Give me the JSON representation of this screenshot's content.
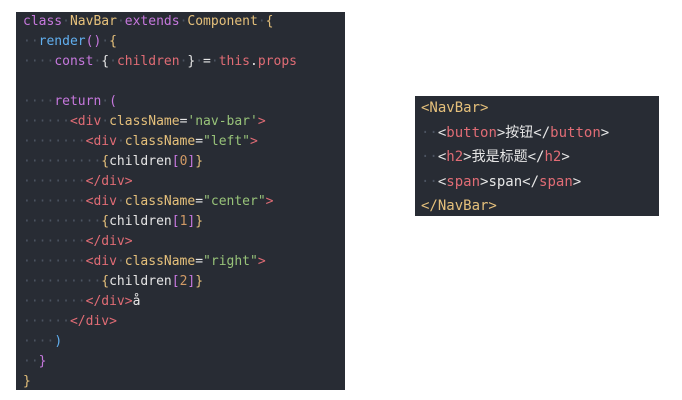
{
  "left_code": [
    [
      [
        "kw",
        "class"
      ],
      [
        "ind",
        "·"
      ],
      [
        "cls",
        "NavBar"
      ],
      [
        "ind",
        "·"
      ],
      [
        "kw",
        "extends"
      ],
      [
        "ind",
        "·"
      ],
      [
        "cls",
        "Component"
      ],
      [
        "ind",
        "·"
      ],
      [
        "brace",
        "{"
      ]
    ],
    [
      [
        "ind",
        "··"
      ],
      [
        "fn",
        "render"
      ],
      [
        "paren",
        "()"
      ],
      [
        "ind",
        "·"
      ],
      [
        "brace",
        "{"
      ]
    ],
    [
      [
        "ind",
        "····"
      ],
      [
        "kw",
        "const"
      ],
      [
        "ind",
        "·"
      ],
      [
        "txt",
        "{"
      ],
      [
        "ind",
        "·"
      ],
      [
        "tag",
        "children"
      ],
      [
        "ind",
        "·"
      ],
      [
        "txt",
        "}"
      ],
      [
        "ind",
        "·"
      ],
      [
        "txt",
        "="
      ],
      [
        "ind",
        "·"
      ],
      [
        "tag",
        "this"
      ],
      [
        "txt",
        "."
      ],
      [
        "tag",
        "props"
      ]
    ],
    [
      [
        "txt",
        ""
      ]
    ],
    [
      [
        "ind",
        "····"
      ],
      [
        "kw",
        "return"
      ],
      [
        "ind",
        "·"
      ],
      [
        "paren",
        "("
      ]
    ],
    [
      [
        "ind",
        "······"
      ],
      [
        "tag",
        "<div"
      ],
      [
        "ind",
        "·"
      ],
      [
        "attr",
        "className"
      ],
      [
        "txt",
        "="
      ],
      [
        "str",
        "'nav-bar'"
      ],
      [
        "tag",
        ">"
      ]
    ],
    [
      [
        "ind",
        "········"
      ],
      [
        "tag",
        "<div"
      ],
      [
        "ind",
        "·"
      ],
      [
        "attr",
        "className"
      ],
      [
        "txt",
        "="
      ],
      [
        "str",
        "\"left\""
      ],
      [
        "tag",
        ">"
      ]
    ],
    [
      [
        "ind",
        "··········"
      ],
      [
        "brace",
        "{"
      ],
      [
        "txt",
        "children"
      ],
      [
        "paren",
        "["
      ],
      [
        "num",
        "0"
      ],
      [
        "paren",
        "]"
      ],
      [
        "brace",
        "}"
      ]
    ],
    [
      [
        "ind",
        "········"
      ],
      [
        "tag",
        "</div>"
      ]
    ],
    [
      [
        "ind",
        "········"
      ],
      [
        "tag",
        "<div"
      ],
      [
        "ind",
        "·"
      ],
      [
        "attr",
        "className"
      ],
      [
        "txt",
        "="
      ],
      [
        "str",
        "\"center\""
      ],
      [
        "tag",
        ">"
      ]
    ],
    [
      [
        "ind",
        "··········"
      ],
      [
        "brace",
        "{"
      ],
      [
        "txt",
        "children"
      ],
      [
        "paren",
        "["
      ],
      [
        "num",
        "1"
      ],
      [
        "paren",
        "]"
      ],
      [
        "brace",
        "}"
      ]
    ],
    [
      [
        "ind",
        "········"
      ],
      [
        "tag",
        "</div>"
      ]
    ],
    [
      [
        "ind",
        "········"
      ],
      [
        "tag",
        "<div"
      ],
      [
        "ind",
        "·"
      ],
      [
        "attr",
        "className"
      ],
      [
        "txt",
        "="
      ],
      [
        "str",
        "\"right\""
      ],
      [
        "tag",
        ">"
      ]
    ],
    [
      [
        "ind",
        "··········"
      ],
      [
        "brace",
        "{"
      ],
      [
        "txt",
        "children"
      ],
      [
        "paren",
        "["
      ],
      [
        "num",
        "2"
      ],
      [
        "paren",
        "]"
      ],
      [
        "brace",
        "}"
      ]
    ],
    [
      [
        "ind",
        "········"
      ],
      [
        "tag",
        "</div>"
      ],
      [
        "txt",
        "å"
      ]
    ],
    [
      [
        "ind",
        "······"
      ],
      [
        "tag",
        "</div>"
      ]
    ],
    [
      [
        "ind",
        "····"
      ],
      [
        "fn",
        ")"
      ]
    ],
    [
      [
        "ind",
        "··"
      ],
      [
        "paren",
        "}"
      ]
    ],
    [
      [
        "brace",
        "}"
      ]
    ]
  ],
  "right_code": [
    [
      [
        "cls",
        "<NavBar>"
      ]
    ],
    [
      [
        "ind",
        "··"
      ],
      [
        "txt",
        "<"
      ],
      [
        "tag",
        "button"
      ],
      [
        "txt",
        ">按钮</"
      ],
      [
        "tag",
        "button"
      ],
      [
        "txt",
        ">"
      ]
    ],
    [
      [
        "ind",
        "··"
      ],
      [
        "txt",
        "<"
      ],
      [
        "tag",
        "h2"
      ],
      [
        "txt",
        ">我是标题</"
      ],
      [
        "tag",
        "h2"
      ],
      [
        "txt",
        ">"
      ]
    ],
    [
      [
        "ind",
        "··"
      ],
      [
        "txt",
        "<"
      ],
      [
        "tag",
        "span"
      ],
      [
        "txt",
        ">span</"
      ],
      [
        "tag",
        "span"
      ],
      [
        "txt",
        ">"
      ]
    ],
    [
      [
        "cls",
        "</NavBar>"
      ]
    ]
  ]
}
